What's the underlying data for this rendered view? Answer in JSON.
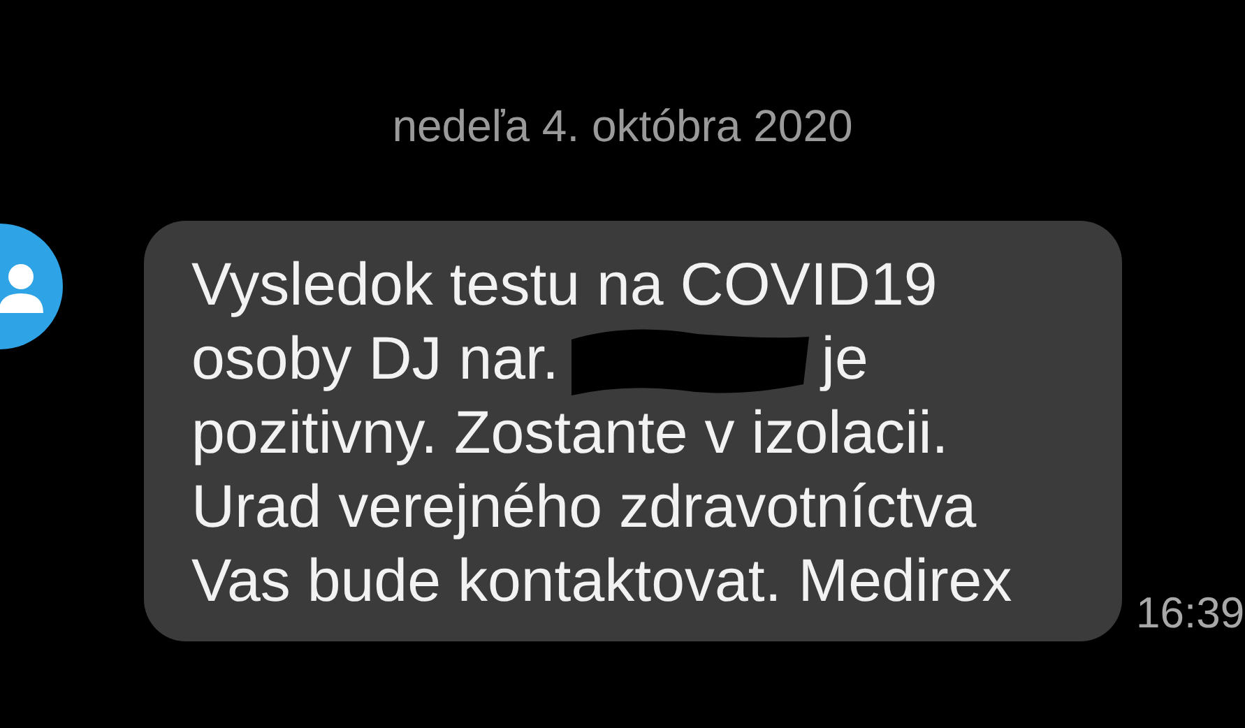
{
  "date_header": "nedeľa 4. októbra 2020",
  "message": {
    "lines": [
      {
        "kind": "text",
        "text": "Vysledok testu na COVID19"
      },
      {
        "kind": "redacted",
        "text": "osoby DJ nar.",
        "text_after": "je"
      },
      {
        "kind": "text",
        "text": "pozitivny. Zostante v izolacii."
      },
      {
        "kind": "text",
        "text": "Urad verejného zdravotníctva"
      },
      {
        "kind": "text",
        "text": "Vas bude kontaktovat. Medirex"
      }
    ],
    "time": "16:39"
  }
}
